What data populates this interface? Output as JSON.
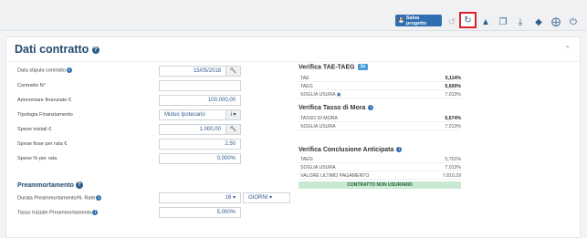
{
  "toolbar": {
    "save_label": "Salva progetto",
    "icons": [
      "undo-icon",
      "redo-icon",
      "warning-icon",
      "copy-icon",
      "download-icon",
      "tag-icon",
      "lifebuoy-icon",
      "power-icon"
    ]
  },
  "card": {
    "title": "Dati contratto",
    "fields": {
      "data_stipula": {
        "label": "Data stipula contratto",
        "value": "15/05/2018"
      },
      "contratto_n": {
        "label": "Contratto N°",
        "value": ""
      },
      "ammontare": {
        "label": "Ammontare finanziato €",
        "value": "100.000,00"
      },
      "tipologia": {
        "label": "Tipologia Finanziamento",
        "value": "Mutuo Ipotecario",
        "addon": "i"
      },
      "spese_iniziali": {
        "label": "Spese iniziali €",
        "value": "1.000,00"
      },
      "spese_fisse": {
        "label": "Spese fisse per rata €",
        "value": "2,50"
      },
      "spese_perc": {
        "label": "Spese % per rata",
        "value": "0,000%"
      }
    },
    "preammortamento": {
      "title": "Preammortamento",
      "durata": {
        "label": "Durata Preammortamento/N. Rate",
        "value": "16",
        "unit": "GIORNI"
      },
      "tasso": {
        "label": "Tasso Iniziale Preammortamento",
        "value": "5,000%"
      }
    }
  },
  "verifica": {
    "taeg": {
      "title": "Verifica TAE-TAEG",
      "tag": "1x",
      "rows": [
        {
          "k": "TAE",
          "v": "5,114%"
        },
        {
          "k": "TAEG",
          "v": "5,600%"
        },
        {
          "k": "SOGLIA USURA",
          "v": "7,013%"
        }
      ]
    },
    "mora": {
      "title": "Verifica Tasso di Mora",
      "rows": [
        {
          "k": "TASSO DI MORA",
          "v": "5,674%"
        },
        {
          "k": "SOGLIA USURA",
          "v": "7,013%"
        }
      ]
    },
    "anticipata": {
      "title": "Verifica Conclusione Anticipata",
      "rows": [
        {
          "k": "TAEG",
          "v": "5,701%"
        },
        {
          "k": "SOGLIA USURA",
          "v": "7,013%"
        },
        {
          "k": "VALORE ULTIMO PAGAMENTO",
          "v": "7.810,29"
        }
      ],
      "result": "CONTRATTO NON USURARIO"
    }
  },
  "colors": {
    "accent": "#2f6fb1",
    "highlight": "#d8232a",
    "ok": "#c9ead2"
  }
}
